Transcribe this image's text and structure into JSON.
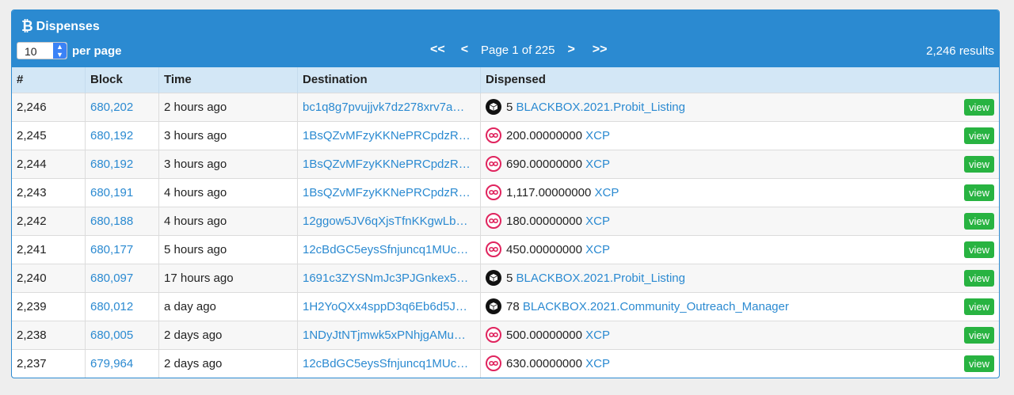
{
  "header": {
    "title": "Dispenses",
    "per_page_value": "10",
    "per_page_label": "per page",
    "first": "<<",
    "prev": "<",
    "page_text": "Page 1 of 225",
    "next": ">",
    "last": ">>",
    "results": "2,246 results"
  },
  "columns": [
    "#",
    "Block",
    "Time",
    "Destination",
    "Dispensed"
  ],
  "view_label": "view",
  "rows": [
    {
      "num": "2,246",
      "block": "680,202",
      "time": "2 hours ago",
      "dest": "bc1q8g7pvujjvk7dz278xrv7a…",
      "qty": "5",
      "asset": "BLACKBOX.2021.Probit_Listing",
      "icon": "blackbox-icon"
    },
    {
      "num": "2,245",
      "block": "680,192",
      "time": "3 hours ago",
      "dest": "1BsQZvMFzyKKNePRCpdzR…",
      "qty": "200.00000000",
      "asset": "XCP",
      "icon": "xcp-icon"
    },
    {
      "num": "2,244",
      "block": "680,192",
      "time": "3 hours ago",
      "dest": "1BsQZvMFzyKKNePRCpdzR…",
      "qty": "690.00000000",
      "asset": "XCP",
      "icon": "xcp-icon"
    },
    {
      "num": "2,243",
      "block": "680,191",
      "time": "4 hours ago",
      "dest": "1BsQZvMFzyKKNePRCpdzR…",
      "qty": "1,117.00000000",
      "asset": "XCP",
      "icon": "xcp-icon"
    },
    {
      "num": "2,242",
      "block": "680,188",
      "time": "4 hours ago",
      "dest": "12ggow5JV6qXjsTfnKKgwLb…",
      "qty": "180.00000000",
      "asset": "XCP",
      "icon": "xcp-icon"
    },
    {
      "num": "2,241",
      "block": "680,177",
      "time": "5 hours ago",
      "dest": "12cBdGC5eysSfnjuncq1MUc…",
      "qty": "450.00000000",
      "asset": "XCP",
      "icon": "xcp-icon"
    },
    {
      "num": "2,240",
      "block": "680,097",
      "time": "17 hours ago",
      "dest": "1691c3ZYSNmJc3PJGnkex5…",
      "qty": "5",
      "asset": "BLACKBOX.2021.Probit_Listing",
      "icon": "blackbox-icon"
    },
    {
      "num": "2,239",
      "block": "680,012",
      "time": "a day ago",
      "dest": "1H2YoQXx4sppD3q6Eb6d5J…",
      "qty": "78",
      "asset": "BLACKBOX.2021.Community_Outreach_Manager",
      "icon": "blackbox-icon"
    },
    {
      "num": "2,238",
      "block": "680,005",
      "time": "2 days ago",
      "dest": "1NDyJtNTjmwk5xPNhjgAMu…",
      "qty": "500.00000000",
      "asset": "XCP",
      "icon": "xcp-icon"
    },
    {
      "num": "2,237",
      "block": "679,964",
      "time": "2 days ago",
      "dest": "12cBdGC5eysSfnjuncq1MUc…",
      "qty": "630.00000000",
      "asset": "XCP",
      "icon": "xcp-icon"
    }
  ],
  "colors": {
    "header_bg": "#2b8ad1",
    "link": "#2b8ad1",
    "view_button": "#28b341",
    "xcp_ring": "#e0245e"
  }
}
